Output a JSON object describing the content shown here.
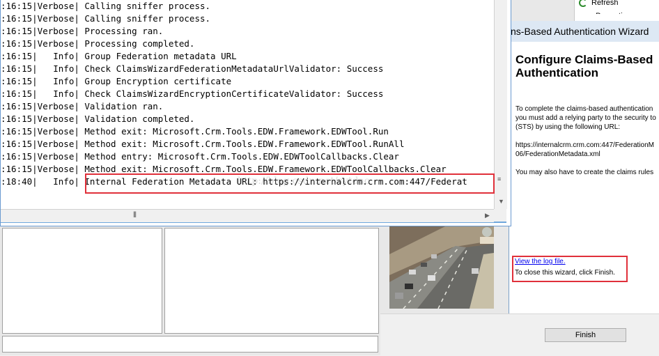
{
  "log": {
    "lines": [
      ":16:15|Verbose| Calling sniffer process.",
      ":16:15|Verbose| Calling sniffer process.",
      ":16:15|Verbose| Processing ran.",
      ":16:15|Verbose| Processing completed.",
      ":16:15|   Info| Group Federation metadata URL",
      ":16:15|   Info| Check ClaimsWizardFederationMetadataUrlValidator: Success",
      ":16:15|   Info| Group Encryption certificate",
      ":16:15|   Info| Check ClaimsWizardEncryptionCertificateValidator: Success",
      ":16:15|Verbose| Validation ran.",
      ":16:15|Verbose| Validation completed.",
      ":16:15|Verbose| Method exit: Microsoft.Crm.Tools.EDW.Framework.EDWTool.Run",
      ":16:15|Verbose| Method exit: Microsoft.Crm.Tools.EDW.Framework.EDWTool.RunAll",
      ":16:15|Verbose| Method entry: Microsoft.Crm.Tools.EDW.EDWToolCallbacks.Clear",
      ":16:15|Verbose| Method exit: Microsoft.Crm.Tools.EDW.Framework.EDWToolCallbacks.Clear",
      ":18:40|   Info| Internal Federation Metadata URL: https://internalcrm.crm.com:447/Federat"
    ],
    "watermark": "http://blog.csdn.net/sytdao"
  },
  "actions": {
    "refresh_label": "Refresh",
    "properties_label": "Properties"
  },
  "wizard": {
    "title": "ns-Based Authentication Wizard",
    "heading_line1": "Configure Claims-Based",
    "heading_line2": "Authentication",
    "para1_line1": "To complete the claims-based authentication",
    "para1_line2": "you must add a relying party to the security to",
    "para1_line3": "(STS) by using the following URL:",
    "url_line1": "https://internalcrm.crm.com:447/FederationM",
    "url_line2": "06/FederationMetadata.xml",
    "para2": "You may also have to create the claims rules",
    "log_link": "View the log file.",
    "close_text": "To close this wizard, click Finish.",
    "finish_label": "Finish"
  },
  "colors": {
    "highlight_box": "#e0303a",
    "link": "#0000ee",
    "window_frame": "#6fa7dc"
  }
}
